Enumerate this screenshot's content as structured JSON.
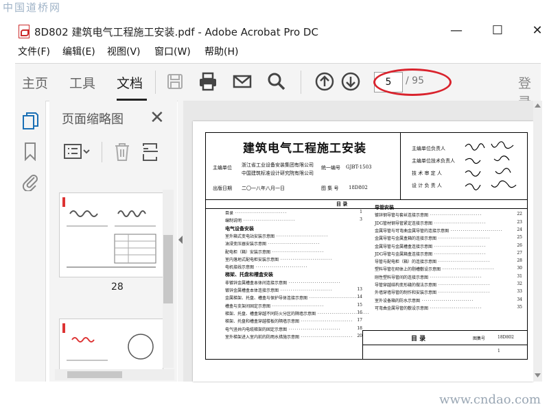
{
  "watermark": {
    "top": "中国道桥网",
    "bottom": "www.cndao.com"
  },
  "window": {
    "title": "8D802 建筑电气工程施工安装.pdf - Adobe Acrobat Pro DC",
    "minimize": "—",
    "maximize": "☐",
    "close": "✕"
  },
  "menu": [
    "文件(F)",
    "编辑(E)",
    "视图(V)",
    "窗口(W)",
    "帮助(H)"
  ],
  "tabs": [
    "主页",
    "工具",
    "文档"
  ],
  "active_tab": "文档",
  "page_nav": {
    "current": "5",
    "total": "/ 95"
  },
  "login": "登录",
  "panel": {
    "title": "页面缩略图",
    "close": "✕",
    "thumb_label": "28"
  },
  "doc": {
    "title": "建筑电气工程施工安装",
    "org_label": "主编单位",
    "org1": "浙江省工业设备安装集团有限公司",
    "org2": "中国建筑标准设计研究院有限公司",
    "code_label": "统一编号",
    "code": "GJBT-1503",
    "date_label": "出版日期",
    "date": "二〇一八年八月一日",
    "atlas_label": "图 集 号",
    "atlas": "18D802",
    "roles": [
      "主编单位负责人",
      "主编单位技术负责人",
      "技 术 审 定 人",
      "设 计 负 责 人"
    ],
    "toc_title": "目 录",
    "bottom_title": "目 录",
    "bottom_atlas_label": "图集号",
    "bottom_atlas": "18D802",
    "bottom_page": "1",
    "toc_left": [
      {
        "t": "目录",
        "p": "1",
        "kind": "line"
      },
      {
        "t": "编制说明",
        "p": "3",
        "kind": "line"
      },
      {
        "t": "电气设备安装",
        "p": "",
        "kind": "head"
      },
      {
        "t": "室外箱式变电站安装示意图",
        "p": "",
        "kind": "line"
      },
      {
        "t": "油浸变压器安装示意图",
        "p": "",
        "kind": "line"
      },
      {
        "t": "配电柜（箱）安装示意图",
        "p": "",
        "kind": "line"
      },
      {
        "t": "室内落地式配电柜安装示意图",
        "p": "",
        "kind": "line"
      },
      {
        "t": "电机接线示意图",
        "p": "",
        "kind": "line"
      },
      {
        "t": "梯架、托盘和槽盒安装",
        "p": "",
        "kind": "head"
      },
      {
        "t": "非镀锌金属槽盒本体间连接示意图",
        "p": "",
        "kind": "line"
      },
      {
        "t": "镀锌金属槽盒本体连接示意图",
        "p": "13",
        "kind": "line"
      },
      {
        "t": "金属梯架、托盘、槽盒与保护导体连接示意图",
        "p": "14",
        "kind": "line"
      },
      {
        "t": "槽盒与支架间固定示意图",
        "p": "15",
        "kind": "line"
      },
      {
        "t": "梯架、托盘、槽盒穿越不同防火分区的隔墙示意图",
        "p": "16",
        "kind": "line"
      },
      {
        "t": "梯架、托盘和槽盒穿越楼板的隔墙示意图",
        "p": "17",
        "kind": "line"
      },
      {
        "t": "电气竖井内电缆梯架的固定示意图",
        "p": "18",
        "kind": "line"
      },
      {
        "t": "室外梯架进入室内前的防雨水措施示意图",
        "p": "20",
        "kind": "line"
      }
    ],
    "toc_right": [
      {
        "t": "导管安装",
        "p": "",
        "kind": "head"
      },
      {
        "t": "镀锌钢导管与套丝连接示意图",
        "p": "22",
        "kind": "line"
      },
      {
        "t": "JDG管材钢导管紧定连接示意图",
        "p": "23",
        "kind": "line"
      },
      {
        "t": "金属导管与可弯曲金属导管的连接示意图",
        "p": "24",
        "kind": "line"
      },
      {
        "t": "金属导管与金属盒箱的连接示意图",
        "p": "25",
        "kind": "line"
      },
      {
        "t": "金属导管与金属槽盒连接示意图",
        "p": "26",
        "kind": "line"
      },
      {
        "t": "JDG导管与金属箱盒连接示意图",
        "p": "27",
        "kind": "line"
      },
      {
        "t": "导管与配电柜（箱）的连接示意图",
        "p": "28",
        "kind": "line"
      },
      {
        "t": "塑料导管在砌体上的剔槽敷设示意图",
        "p": "30",
        "kind": "line"
      },
      {
        "t": "刚性塑料导管间的连接示意图",
        "p": "31",
        "kind": "line"
      },
      {
        "t": "导管穿越结构变形缝的做法示意图",
        "p": "32",
        "kind": "line"
      },
      {
        "t": "外墙穿墙导管的制作和安装示意图",
        "p": "33",
        "kind": "line"
      },
      {
        "t": "室外设备箱的防水示意图",
        "p": "34",
        "kind": "line"
      },
      {
        "t": "可弯曲金属导管的敷设示意图",
        "p": "35",
        "kind": "line"
      }
    ]
  },
  "colors": {
    "accent_red": "#d9232d",
    "toolbar_bg": "#f4f4f4",
    "link_blue": "#1a6fb5"
  }
}
